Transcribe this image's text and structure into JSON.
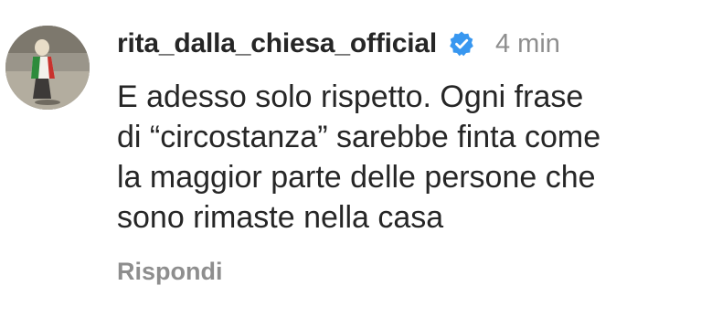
{
  "comment": {
    "username": "rita_dalla_chiesa_official",
    "verified_icon": "verified-badge-icon",
    "time": "4 min",
    "text": "E adesso solo rispetto. Ogni frase\ndi “circostanza” sarebbe finta come\nla maggior parte delle persone che\nsono rimaste nella casa",
    "reply_label": "Rispondi",
    "colors": {
      "text": "#262626",
      "secondary": "#8e8e8e",
      "verified": "#3897f0"
    }
  }
}
